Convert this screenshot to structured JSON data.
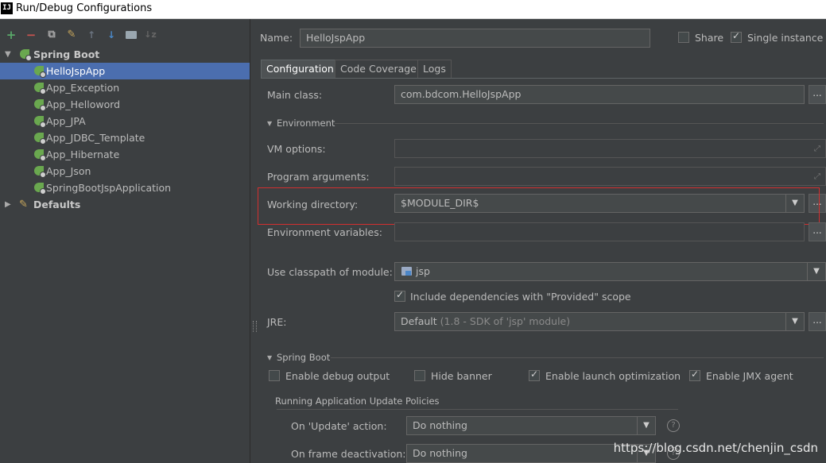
{
  "window": {
    "title": "Run/Debug Configurations",
    "app_icon_text": "IJ"
  },
  "toolbar": [
    "add-icon",
    "remove-icon",
    "copy-icon",
    "edit-defaults-icon",
    "move-up-icon",
    "move-down-icon",
    "folder-icon",
    "sort-icon"
  ],
  "tree": {
    "group": "Spring Boot",
    "items": [
      {
        "label": "HelloJspApp",
        "selected": true
      },
      {
        "label": "App_Exception"
      },
      {
        "label": "App_Helloword"
      },
      {
        "label": "App_JPA"
      },
      {
        "label": "App_JDBC_Template"
      },
      {
        "label": "App_Hibernate"
      },
      {
        "label": "App_Json"
      },
      {
        "label": "SpringBootJspApplication"
      }
    ],
    "defaults": "Defaults"
  },
  "header": {
    "name_label": "Name:",
    "name_value": "HelloJspApp",
    "share_label": "Share",
    "share_checked": false,
    "single_instance_label": "Single instance o",
    "single_instance_checked": true
  },
  "tabs": [
    "Configuration",
    "Code Coverage",
    "Logs"
  ],
  "active_tab": "Configuration",
  "config": {
    "main_class_label": "Main class:",
    "main_class_value": "com.bdcom.HelloJspApp",
    "environment_section": "Environment",
    "vm_options_label": "VM options:",
    "vm_options_value": "",
    "program_args_label": "Program arguments:",
    "program_args_value": "",
    "working_dir_label": "Working directory:",
    "working_dir_value": "$MODULE_DIR$",
    "env_vars_label": "Environment variables:",
    "env_vars_value": "",
    "classpath_label": "Use classpath of module:",
    "classpath_value": "jsp",
    "include_deps_label": "Include dependencies with \"Provided\" scope",
    "include_deps_checked": true,
    "jre_label": "JRE:",
    "jre_value_main": "Default",
    "jre_value_detail": "(1.8 - SDK of 'jsp' module)",
    "browse_label": "..."
  },
  "spring_boot": {
    "section": "Spring Boot",
    "debug_output_label": "Enable debug output",
    "debug_output_checked": false,
    "hide_banner_label": "Hide banner",
    "hide_banner_checked": false,
    "launch_opt_label": "Enable launch optimization",
    "launch_opt_checked": true,
    "jmx_label": "Enable JMX agent",
    "jmx_checked": true,
    "policies_title": "Running Application Update Policies",
    "on_update_label": "On 'Update' action:",
    "on_update_value": "Do nothing",
    "on_frame_label": "On frame deactivation:",
    "on_frame_value": "Do nothing",
    "help_glyph": "?"
  },
  "watermark": "https://blog.csdn.net/chenjin_csdn",
  "colors": {
    "selection": "#4b6eaf",
    "highlight_box": "#d32f2f",
    "spring_green": "#6aa84f"
  }
}
